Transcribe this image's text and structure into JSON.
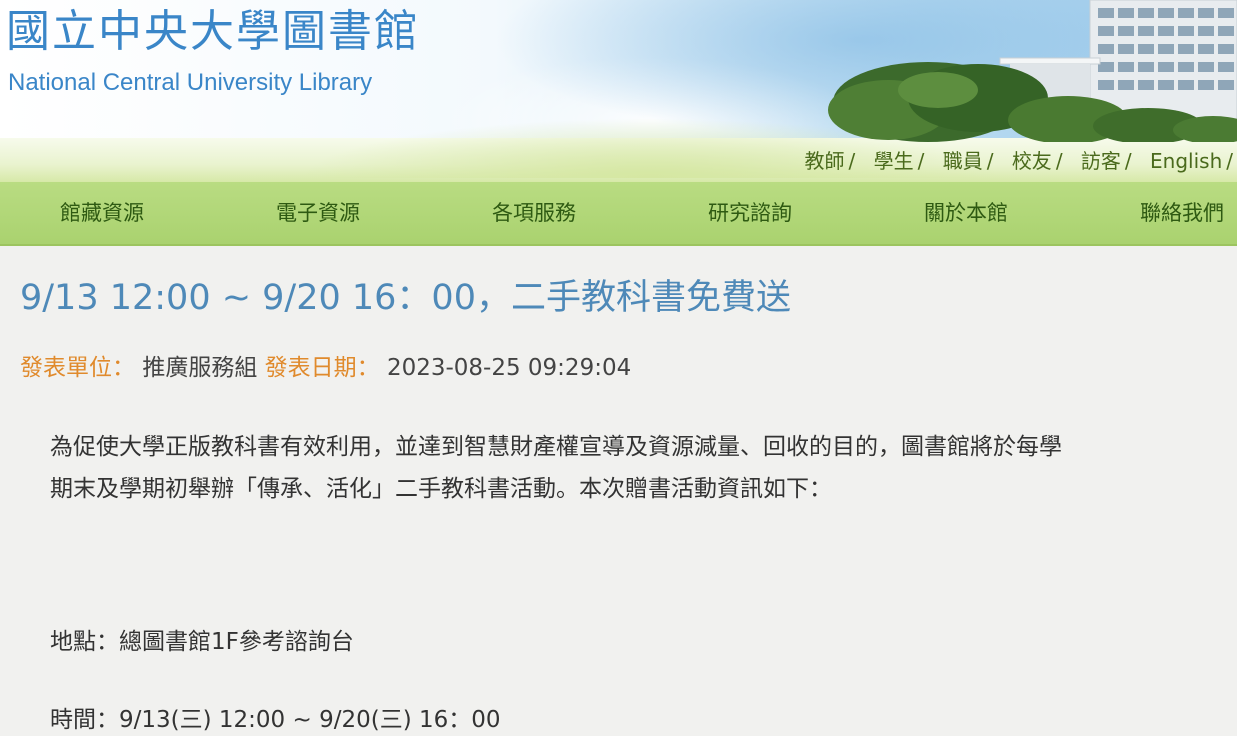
{
  "header": {
    "title_zh": "國立中央大學圖書館",
    "title_en": "National Central University Library",
    "quick_links": [
      "教師",
      "學生",
      "職員",
      "校友",
      "訪客",
      "English"
    ],
    "separator": "/"
  },
  "nav": {
    "items": [
      "館藏資源",
      "電子資源",
      "各項服務",
      "研究諮詢",
      "關於本館",
      "聯絡我們"
    ]
  },
  "post": {
    "title": "9/13 12:00 ~ 9/20 16：00，二手教科書免費送",
    "unit_label": "發表單位：",
    "unit_value": "推廣服務組",
    "date_label": "發表日期：",
    "date_value": "2023-08-25 09:29:04",
    "body_line1": "為促使大學正版教科書有效利用，並達到智慧財產權宣導及資源減量、回收的目的，圖書館將於每學",
    "body_line2": "期末及學期初舉辦「傳承、活化」二手教科書活動。本次贈書活動資訊如下：",
    "location": "地點：總圖書館1F參考諮詢台",
    "time": "時間：9/13(三) 12:00 ~ 9/20(三) 16：00"
  },
  "colors": {
    "title_blue": "#3a86c8",
    "nav_green": "#b2d779",
    "label_orange": "#e08a2c",
    "post_title_blue": "#4e89b8"
  }
}
